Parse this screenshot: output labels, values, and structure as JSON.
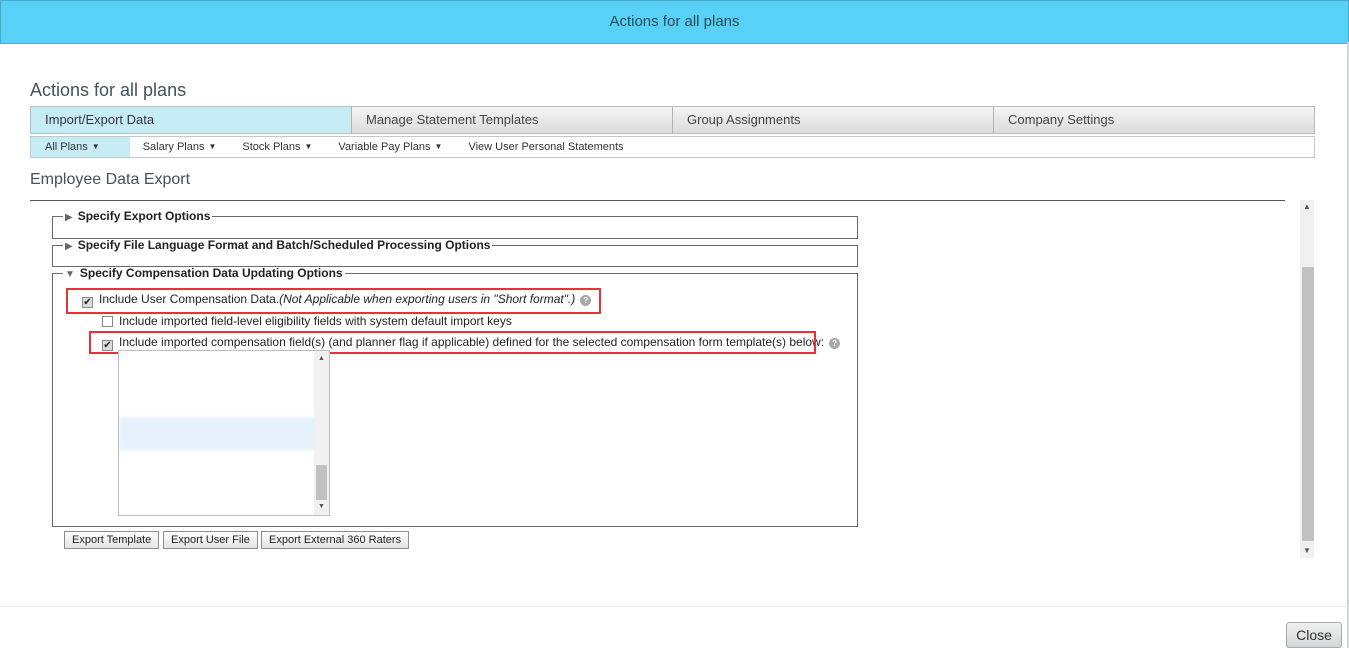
{
  "dialog": {
    "title": "Actions for all plans",
    "close_label": "Close"
  },
  "page": {
    "heading": "Actions for all plans",
    "section_heading": "Employee Data Export"
  },
  "main_tabs": [
    {
      "label": "Import/Export Data",
      "active": true
    },
    {
      "label": "Manage Statement Templates",
      "active": false
    },
    {
      "label": "Group Assignments",
      "active": false
    },
    {
      "label": "Company Settings",
      "active": false
    }
  ],
  "sub_tabs": [
    {
      "label": "All Plans",
      "has_dropdown": true,
      "active": true
    },
    {
      "label": "Salary Plans",
      "has_dropdown": true,
      "active": false
    },
    {
      "label": "Stock Plans",
      "has_dropdown": true,
      "active": false
    },
    {
      "label": "Variable Pay Plans",
      "has_dropdown": true,
      "active": false
    },
    {
      "label": "View User Personal Statements",
      "has_dropdown": false,
      "active": false
    }
  ],
  "groups": {
    "export_options": {
      "label": "Specify Export Options",
      "expanded": false
    },
    "file_language": {
      "label": "Specify File Language Format and Batch/Scheduled Processing Options",
      "expanded": false
    },
    "comp_updating": {
      "label": "Specify Compensation Data Updating Options",
      "expanded": true
    }
  },
  "options": {
    "include_user_comp": {
      "label": "Include User Compensation Data.",
      "note": "(Not Applicable when exporting users in \"Short format\".)",
      "checked": true
    },
    "include_eligibility": {
      "label": "Include imported field-level eligibility fields with system default import keys",
      "checked": false
    },
    "include_comp_fields": {
      "label": "Include imported compensation field(s) (and planner flag if applicable) defined for the selected compensation form template(s) below:",
      "checked": true
    }
  },
  "buttons": {
    "export_template": "Export Template",
    "export_user_file": "Export User File",
    "export_360": "Export External 360 Raters"
  },
  "colors": {
    "titlebar": "#57d1f6",
    "active_tab": "#c6ecf6",
    "highlight": "#e8313a"
  },
  "icons": {
    "expand": "▶",
    "collapse": "▼",
    "help": "?",
    "caret": "▼",
    "check": "✔"
  }
}
